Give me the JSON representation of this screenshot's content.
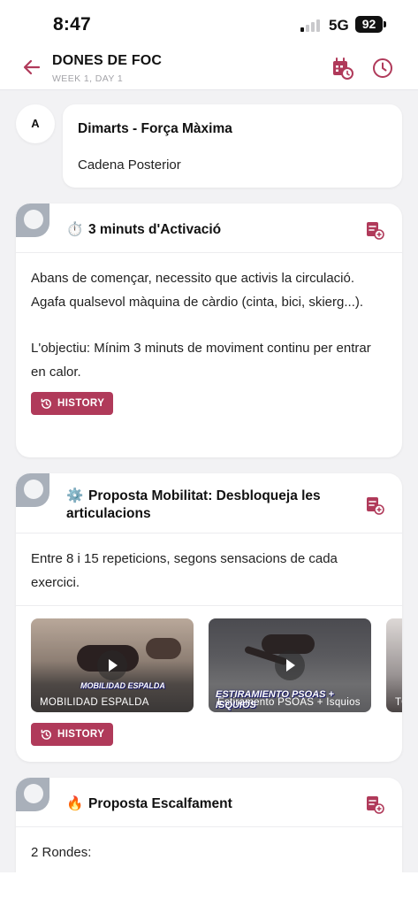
{
  "status_bar": {
    "time": "8:47",
    "network": "5G",
    "battery": "92"
  },
  "header": {
    "title": "DONES DE FOC",
    "subtitle": "WEEK 1, DAY 1"
  },
  "day": {
    "label": "A",
    "title": "Dimarts - Força Màxima",
    "subtitle": "Cadena Posterior"
  },
  "sections": [
    {
      "emoji": "⏱️",
      "title": "3 minuts d'Activació",
      "paragraph1": "Abans de començar, necessito que activis la circulació. Agafa qualsevol màquina de càrdio (cinta, bici, skierg...).",
      "paragraph2": "L'objectiu: Mínim 3 minuts de moviment continu per entrar en calor.",
      "history_label": "HISTORY"
    },
    {
      "emoji": "⚙️",
      "title": "Proposta Mobilitat: Desbloqueja les articulacions",
      "paragraph1": "Entre 8 i 15 repeticions, segons sensacions de cada exercici.",
      "history_label": "HISTORY",
      "videos": [
        {
          "tag": "MOBILIDAD ESPALDA",
          "label": "MOBILIDAD ESPALDA"
        },
        {
          "tag": "ESTIRAMIENTO PSOAS + ISQUIOS",
          "label": "Estiramento PSOAS + Isquios"
        },
        {
          "label": "TO"
        }
      ]
    },
    {
      "emoji": "🔥",
      "title": "Proposta Escalfament",
      "paragraph1": "2 Rondes:"
    }
  ],
  "colors": {
    "accent": "#b03a5a",
    "corner": "#a9b0ba"
  },
  "icons": {
    "back": "arrow-left-icon",
    "calendar": "calendar-clock-icon",
    "history": "clock-icon",
    "note": "add-note-icon"
  }
}
